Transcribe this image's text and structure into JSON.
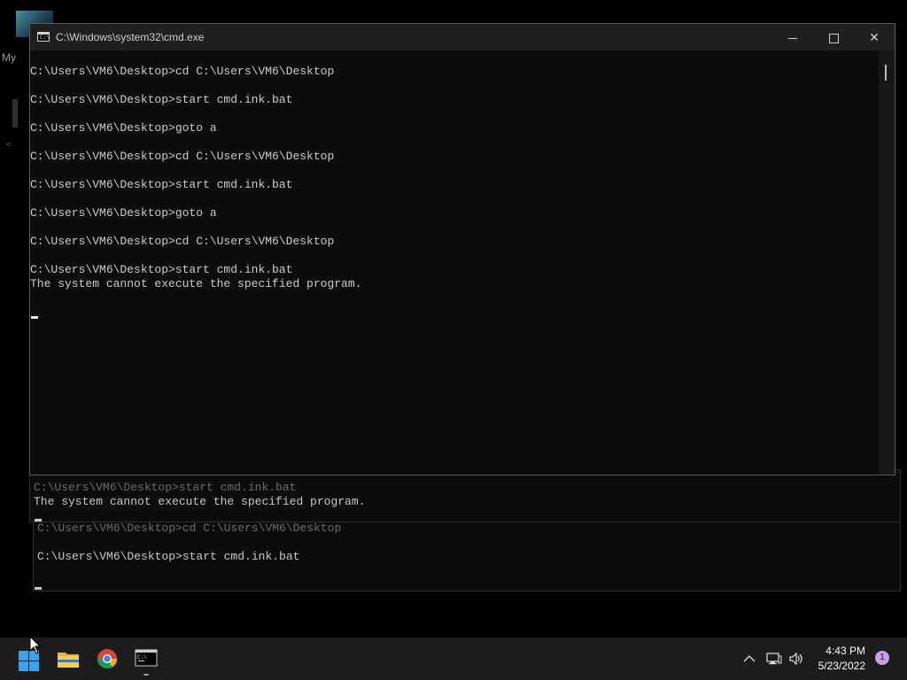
{
  "desktop": {
    "icon_label": "My",
    "tiny_label": "<"
  },
  "background_window_1": {
    "lines": [
      {
        "text": "C:\\Users\\VM6\\Desktop>start cmd.ink.bat",
        "style": "dim"
      },
      {
        "text": "The system cannot execute the specified program.",
        "style": "txt"
      }
    ]
  },
  "background_window_2": {
    "lines": [
      {
        "text": "C:\\Users\\VM6\\Desktop>cd C:\\Users\\VM6\\Desktop",
        "style": "dim"
      },
      {
        "text": "",
        "style": "txt"
      },
      {
        "text": "C:\\Users\\VM6\\Desktop>start cmd.ink.bat",
        "style": "txt"
      }
    ]
  },
  "window": {
    "title": "C:\\Windows\\system32\\cmd.exe",
    "icon": "cmd-icon",
    "icon_text": "C:\\",
    "controls": {
      "minimize": "minimize-icon",
      "maximize": "maximize-icon",
      "close": "close-icon",
      "close_glyph": "✕"
    }
  },
  "console": {
    "lines": [
      "C:\\Users\\VM6\\Desktop>cd C:\\Users\\VM6\\Desktop",
      "",
      "C:\\Users\\VM6\\Desktop>start cmd.ink.bat",
      "",
      "C:\\Users\\VM6\\Desktop>goto a",
      "",
      "C:\\Users\\VM6\\Desktop>cd C:\\Users\\VM6\\Desktop",
      "",
      "C:\\Users\\VM6\\Desktop>start cmd.ink.bat",
      "",
      "C:\\Users\\VM6\\Desktop>goto a",
      "",
      "C:\\Users\\VM6\\Desktop>cd C:\\Users\\VM6\\Desktop",
      "",
      "C:\\Users\\VM6\\Desktop>start cmd.ink.bat",
      "The system cannot execute the specified program."
    ]
  },
  "taskbar": {
    "apps": [
      "windows-start-icon",
      "file-explorer-icon",
      "chrome-icon",
      "command-prompt-icon"
    ],
    "tray": [
      "chevron-up-icon",
      "network-icon",
      "volume-icon"
    ],
    "time": "4:43 PM",
    "date": "5/23/2022",
    "notification_count": "1"
  },
  "colors": {
    "console_bg": "#0c0c0c",
    "console_text": "#cccccc",
    "taskbar_bg": "#1c1c1c",
    "start_blue": "#3aa3f0",
    "badge": "#c9a0e8"
  }
}
